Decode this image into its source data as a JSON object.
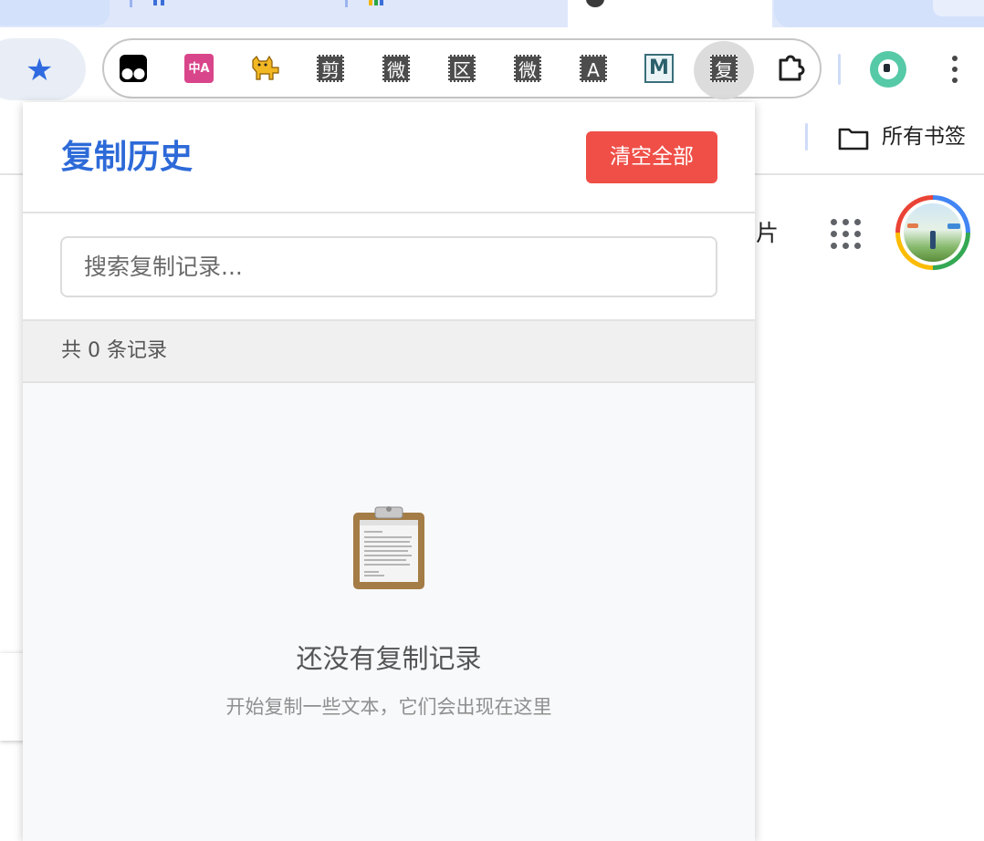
{
  "app": {
    "popup_title": "复制历史",
    "clear_all_label": "清空全部",
    "search_placeholder": "搜索复制记录...",
    "record_count_text": "共 0 条记录",
    "empty_title": "还没有复制记录",
    "empty_subtitle": "开始复制一些文本，它们会出现在这里"
  },
  "toolbar": {
    "extensions": [
      {
        "name": "tampermonkey",
        "glyph": ""
      },
      {
        "name": "translate",
        "glyph": "中A"
      },
      {
        "name": "cat",
        "glyph": ""
      },
      {
        "name": "jian",
        "glyph": "剪"
      },
      {
        "name": "wei",
        "glyph": "微"
      },
      {
        "name": "qu",
        "glyph": "区"
      },
      {
        "name": "wei2",
        "glyph": "微"
      },
      {
        "name": "a",
        "glyph": "A"
      },
      {
        "name": "m",
        "glyph": "M"
      },
      {
        "name": "fu",
        "glyph": "复"
      }
    ]
  },
  "bookmarks": {
    "all_bookmarks_label": "所有书签"
  },
  "page": {
    "partial_text": "片"
  },
  "colors": {
    "accent": "#2d6ad8",
    "danger": "#ef4f47",
    "star": "#2f6ae0"
  }
}
